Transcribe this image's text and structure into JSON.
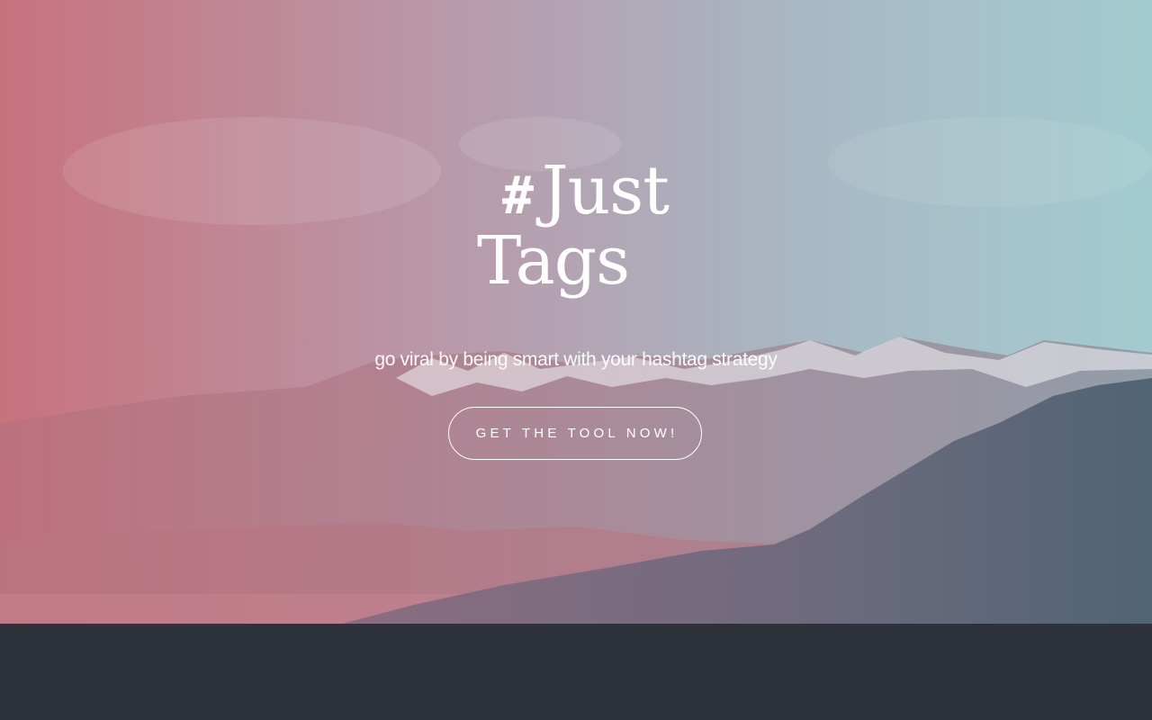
{
  "hero": {
    "logo": {
      "hash": "#",
      "word1": "Just",
      "word2": "Tags"
    },
    "tagline": "go viral by being smart with your hashtag strategy",
    "cta_label": "GET THE TOOL NOW!"
  },
  "colors": {
    "gradient_left": "#c4707c",
    "gradient_right": "#9ec6cc",
    "footer_bg": "#2e323b",
    "text": "#ffffff"
  }
}
